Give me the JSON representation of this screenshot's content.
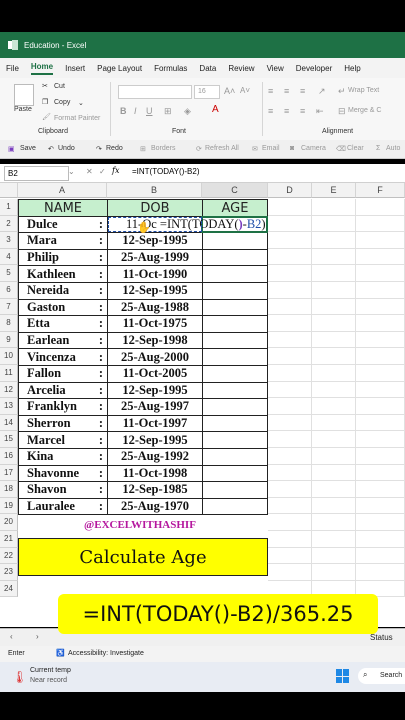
{
  "window": {
    "title": "Education  -  Excel"
  },
  "menu": [
    "File",
    "Home",
    "Insert",
    "Page Layout",
    "Formulas",
    "Data",
    "Review",
    "View",
    "Developer",
    "Help"
  ],
  "menu_active": "Home",
  "ribbon": {
    "paste": "Paste",
    "cut": "Cut",
    "copy": "Copy",
    "format_painter": "Format Painter",
    "clipboard": "Clipboard",
    "font_size": "16",
    "font_group": "Font",
    "wrap_text": "Wrap Text",
    "merge": "Merge & C",
    "alignment": "Alignment"
  },
  "qat": {
    "save": "Save",
    "undo": "Undo",
    "redo": "Redo",
    "borders": "Borders",
    "refresh": "Refresh All",
    "email": "Email",
    "camera": "Camera",
    "clear": "Clear",
    "auto": "Auto"
  },
  "formula_bar": {
    "name_box": "B2",
    "fx": "fx",
    "formula": "=INT(TODAY()-B2)"
  },
  "columns": [
    "A",
    "B",
    "C",
    "D",
    "E",
    "F"
  ],
  "selected_column": "C",
  "rows": [
    "1",
    "2",
    "3",
    "4",
    "5",
    "6",
    "7",
    "8",
    "9",
    "10",
    "11",
    "12",
    "13",
    "14",
    "15",
    "16",
    "17",
    "18",
    "19",
    "20",
    "21",
    "22",
    "23",
    "24"
  ],
  "table": {
    "headers": {
      "name": "NAME",
      "dob": "DOB",
      "age": "AGE"
    },
    "separator": ":",
    "records": [
      {
        "name": "Dulce",
        "dob": "11-Oc"
      },
      {
        "name": "Mara",
        "dob": "12-Sep-1995"
      },
      {
        "name": "Philip",
        "dob": "25-Aug-1999"
      },
      {
        "name": "Kathleen",
        "dob": "11-Oct-1990"
      },
      {
        "name": "Nereida",
        "dob": "12-Sep-1995"
      },
      {
        "name": "Gaston",
        "dob": "25-Aug-1988"
      },
      {
        "name": "Etta",
        "dob": "11-Oct-1975"
      },
      {
        "name": "Earlean",
        "dob": "12-Sep-1998"
      },
      {
        "name": "Vincenza",
        "dob": "25-Aug-2000"
      },
      {
        "name": "Fallon",
        "dob": "11-Oct-2005"
      },
      {
        "name": "Arcelia",
        "dob": "12-Sep-1995"
      },
      {
        "name": "Franklyn",
        "dob": "25-Aug-1997"
      },
      {
        "name": "Sherron",
        "dob": "11-Oct-1997"
      },
      {
        "name": "Marcel",
        "dob": "12-Sep-1995"
      },
      {
        "name": "Kina",
        "dob": "25-Aug-1992"
      },
      {
        "name": "Shavonne",
        "dob": "11-Oct-1998"
      },
      {
        "name": "Shavon",
        "dob": "12-Sep-1985"
      },
      {
        "name": "Lauralee",
        "dob": "25-Aug-1970"
      }
    ],
    "editing_formula": {
      "prefix": "=INT(TODAY(",
      "paren": ")",
      "minus": "-",
      "ref": "B2",
      "close": ")"
    }
  },
  "watermark": "@EXCELWITHASHIF",
  "banner": "Calculate Age",
  "big_formula": "=INT(TODAY()-B2)/365.25",
  "status_tab": "Status",
  "status_bar": {
    "mode": "Enter",
    "accessibility": "Accessibility: Investigate"
  },
  "taskbar": {
    "weather_title": "Current temp",
    "weather_sub": "Near record",
    "search": "Search"
  },
  "colors": {
    "excel_green": "#1e7145",
    "header_fill": "#c6efce",
    "yellow": "#ffff00",
    "ref_blue": "#1f4ea8"
  }
}
